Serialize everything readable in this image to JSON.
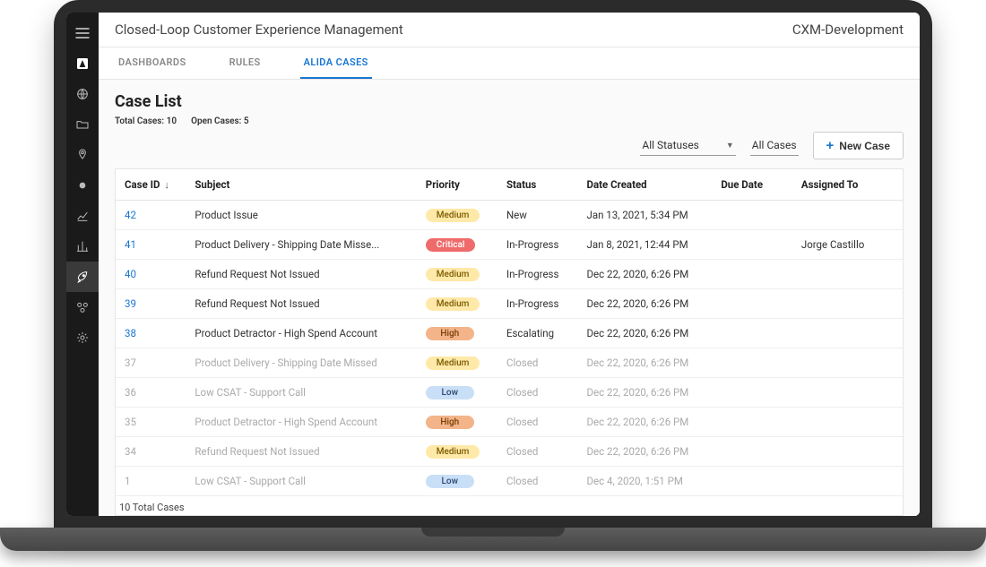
{
  "header": {
    "title": "Closed-Loop Customer Experience Management",
    "env": "CXM-Development"
  },
  "tabs": [
    {
      "label": "DASHBOARDS",
      "active": false
    },
    {
      "label": "RULES",
      "active": false
    },
    {
      "label": "ALIDA CASES",
      "active": true
    }
  ],
  "page": {
    "title": "Case List",
    "total_cases_label": "Total Cases: 10",
    "open_cases_label": "Open Cases: 5",
    "footer_count": "10 Total Cases"
  },
  "filters": {
    "status": "All Statuses",
    "scope": "All Cases",
    "new_case_label": "New Case"
  },
  "columns": {
    "case_id": "Case ID",
    "subject": "Subject",
    "priority": "Priority",
    "status": "Status",
    "date_created": "Date Created",
    "due_date": "Due Date",
    "assigned_to": "Assigned To"
  },
  "rows": [
    {
      "id": "42",
      "subject": "Product Issue",
      "priority": "Medium",
      "status": "New",
      "date": "Jan 13, 2021, 5:34 PM",
      "due": "",
      "assigned": "",
      "closed": false
    },
    {
      "id": "41",
      "subject": "Product Delivery - Shipping Date Misse...",
      "priority": "Critical",
      "status": "In-Progress",
      "date": "Jan 8, 2021, 12:44 PM",
      "due": "",
      "assigned": "Jorge Castillo",
      "closed": false
    },
    {
      "id": "40",
      "subject": "Refund Request Not Issued",
      "priority": "Medium",
      "status": "In-Progress",
      "date": "Dec 22, 2020, 6:26 PM",
      "due": "",
      "assigned": "",
      "closed": false
    },
    {
      "id": "39",
      "subject": "Refund Request Not Issued",
      "priority": "Medium",
      "status": "In-Progress",
      "date": "Dec 22, 2020, 6:26 PM",
      "due": "",
      "assigned": "",
      "closed": false
    },
    {
      "id": "38",
      "subject": "Product Detractor - High Spend Account",
      "priority": "High",
      "status": "Escalating",
      "date": "Dec 22, 2020, 6:26 PM",
      "due": "",
      "assigned": "",
      "closed": false
    },
    {
      "id": "37",
      "subject": "Product Delivery - Shipping Date Missed",
      "priority": "Medium",
      "status": "Closed",
      "date": "Dec 22, 2020, 6:26 PM",
      "due": "",
      "assigned": "",
      "closed": true
    },
    {
      "id": "36",
      "subject": "Low CSAT - Support Call",
      "priority": "Low",
      "status": "Closed",
      "date": "Dec 22, 2020, 6:26 PM",
      "due": "",
      "assigned": "",
      "closed": true
    },
    {
      "id": "35",
      "subject": "Product Detractor - High Spend Account",
      "priority": "High",
      "status": "Closed",
      "date": "Dec 22, 2020, 6:26 PM",
      "due": "",
      "assigned": "",
      "closed": true
    },
    {
      "id": "34",
      "subject": "Refund Request Not Issued",
      "priority": "Medium",
      "status": "Closed",
      "date": "Dec 22, 2020, 6:26 PM",
      "due": "",
      "assigned": "",
      "closed": true
    },
    {
      "id": "1",
      "subject": "Low CSAT - Support Call",
      "priority": "Low",
      "status": "Closed",
      "date": "Dec 4, 2020, 1:51 PM",
      "due": "",
      "assigned": "",
      "closed": true
    }
  ],
  "sidebar_icons": [
    "menu-icon",
    "logo-icon",
    "globe-icon",
    "folder-icon",
    "pin-icon",
    "dot-icon",
    "chart-line-icon",
    "chart-bar-icon",
    "rocket-icon",
    "cluster-icon",
    "gear-icon"
  ]
}
